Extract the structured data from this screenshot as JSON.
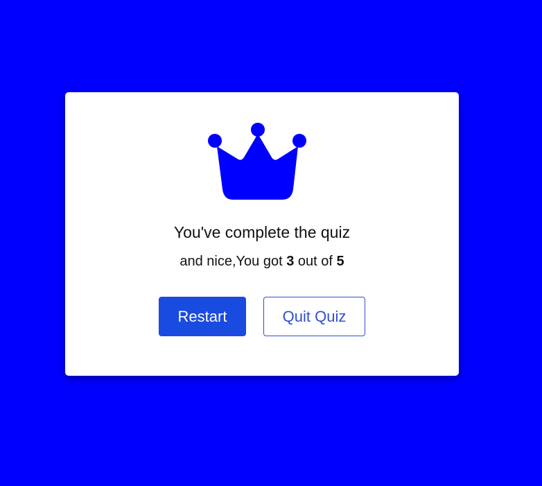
{
  "colors": {
    "background": "#0000ff",
    "crown": "#0000ff",
    "primary_button": "#1a4be0"
  },
  "result": {
    "icon": "crown-icon",
    "title": "You've complete the quiz",
    "prefix": "and nice,You got",
    "score": "3",
    "middle": "out of",
    "total": "5"
  },
  "buttons": {
    "restart": "Restart",
    "quit": "Quit Quiz"
  }
}
